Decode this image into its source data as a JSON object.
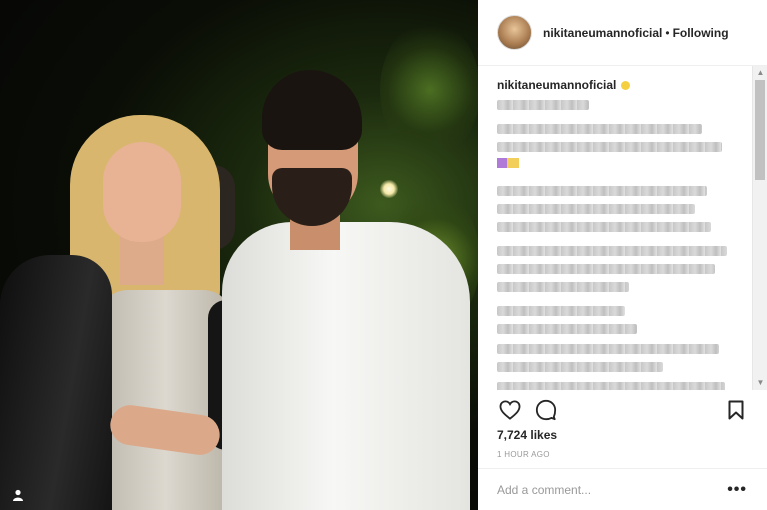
{
  "post": {
    "username": "nikitaneumannoficial",
    "follow_status": "Following",
    "separator": "•",
    "likes": "7,724 likes",
    "timestamp": "1 HOUR AGO",
    "comment_placeholder": "Add a comment...",
    "more_label": "•••"
  },
  "icons": {
    "like": "heart-icon",
    "comment": "comment-bubble-icon",
    "save": "bookmark-icon",
    "photo_tag": "user-tag-icon",
    "verified": "verified-badge-icon"
  },
  "colors": {
    "text": "#262626",
    "muted": "#999999",
    "border": "#efefef",
    "verified": "#f4d041"
  }
}
